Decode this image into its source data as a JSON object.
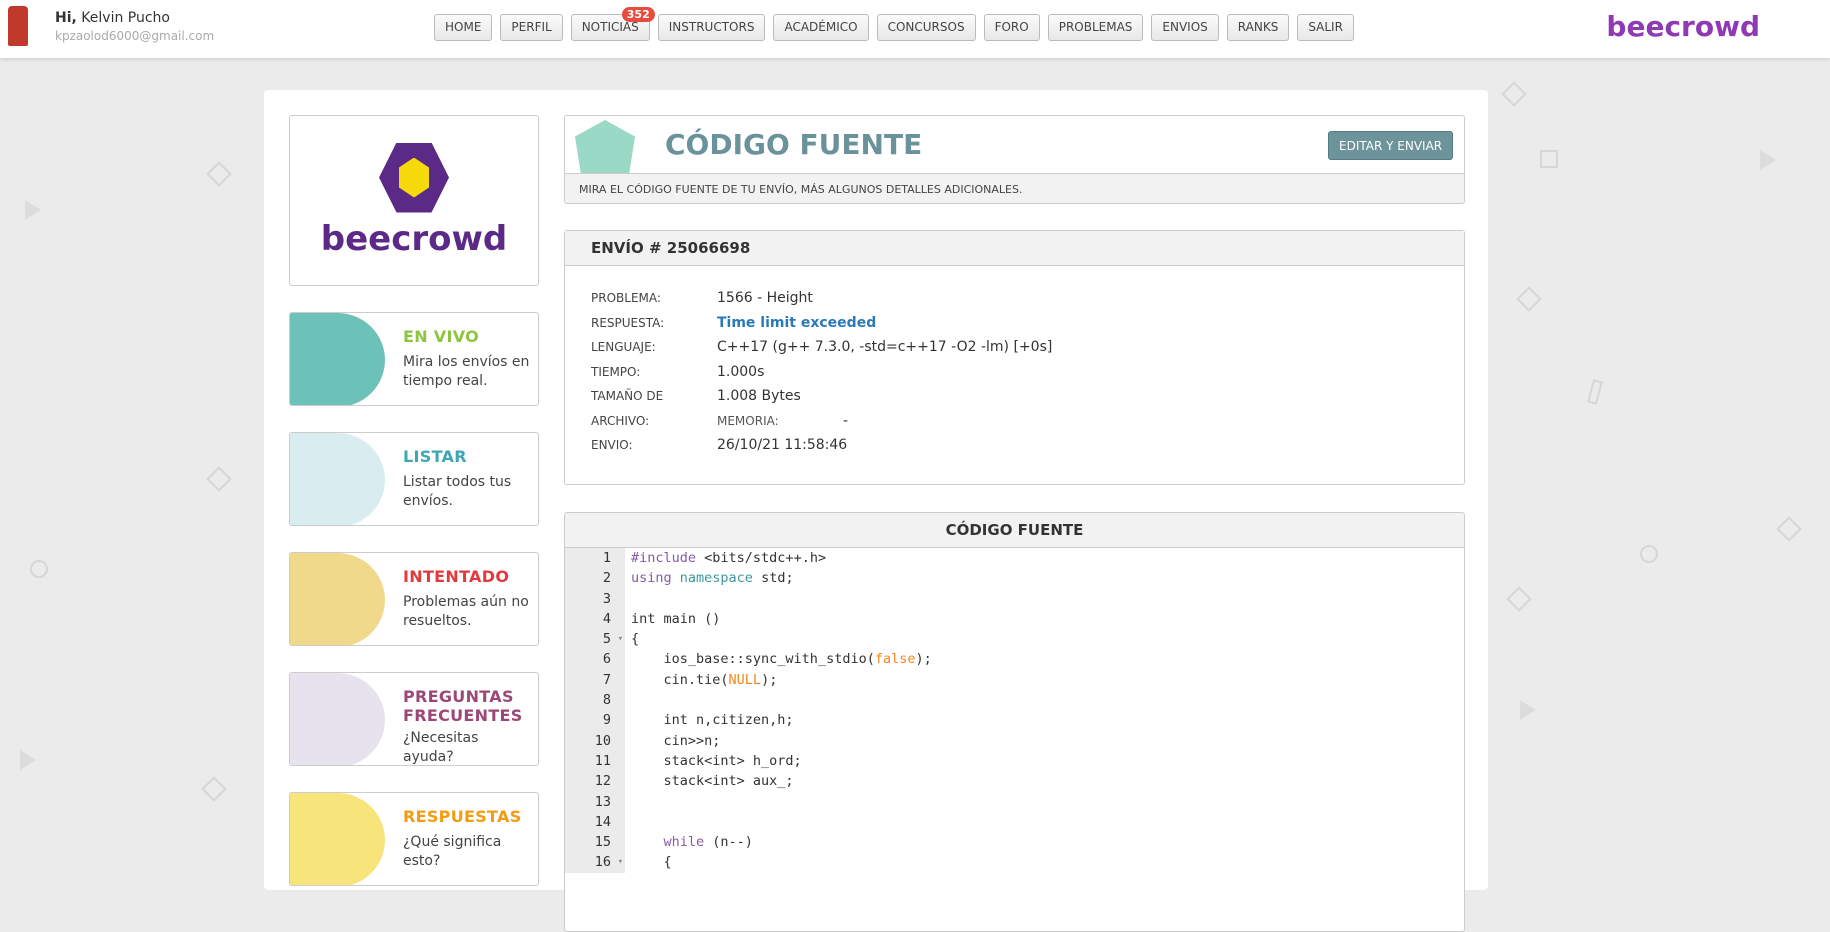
{
  "user": {
    "greeting": "Hi,",
    "name": "Kelvin Pucho",
    "email": "kpzaolod6000@gmail.com"
  },
  "nav": [
    {
      "label": "HOME"
    },
    {
      "label": "PERFIL"
    },
    {
      "label": "NOTICIAS",
      "badge": "352"
    },
    {
      "label": "INSTRUCTORS"
    },
    {
      "label": "ACADÉMICO"
    },
    {
      "label": "CONCURSOS"
    },
    {
      "label": "FORO"
    },
    {
      "label": "PROBLEMAS"
    },
    {
      "label": "ENVIOS"
    },
    {
      "label": "RANKS"
    },
    {
      "label": "SALIR"
    }
  ],
  "brand": "beecrowd",
  "sidebar": {
    "logo_text": "beecrowd",
    "cards": [
      {
        "title": "EN VIVO",
        "desc": "Mira los envíos en tiempo real.",
        "color": "#8cc63f"
      },
      {
        "title": "LISTAR",
        "desc": "Listar todos tus envíos.",
        "color": "#3ea6b5"
      },
      {
        "title": "INTENTADO",
        "desc": "Problemas aún no resueltos.",
        "color": "#e03a3e"
      },
      {
        "title": "PREGUNTAS FRECUENTES",
        "desc": "¿Necesitas ayuda?",
        "color": "#9b4777"
      },
      {
        "title": "RESPUESTAS",
        "desc": "¿Qué significa esto?",
        "color": "#f39c12"
      }
    ]
  },
  "page": {
    "title": "CÓDIGO FUENTE",
    "edit_button": "EDITAR Y ENVIAR",
    "description": "MIRA EL CÓDIGO FUENTE DE TU ENVÍO, MÁS ALGUNOS DETALLES ADICIONALES."
  },
  "submission": {
    "heading": "ENVÍO # 25066698",
    "rows": [
      {
        "label": "PROBLEMA:",
        "value": "1566 - Height"
      },
      {
        "label": "RESPUESTA:",
        "value": "Time limit exceeded"
      },
      {
        "label": "LENGUAJE:",
        "value": "C++17 (g++ 7.3.0, -std=c++17 -O2 -lm) [+0s]"
      },
      {
        "label": "TIEMPO:",
        "value": "1.000s"
      },
      {
        "label": "TAMAÑO DE",
        "value": "1.008 Bytes"
      },
      {
        "label": "ARCHIVO:",
        "value": "MEMORIA:",
        "extra": "-"
      },
      {
        "label": "ENVIO:",
        "value": "26/10/21 11:58:46"
      }
    ]
  },
  "code": {
    "heading": "CÓDIGO FUENTE",
    "lines": [
      "#include <bits/stdc++.h>",
      "using namespace std;",
      "",
      "int main ()",
      "{",
      "    ios_base::sync_with_stdio(false);",
      "    cin.tie(NULL);",
      "",
      "    int n,citizen,h;",
      "    cin>>n;",
      "    stack<int> h_ord;",
      "    stack<int> aux_;",
      "",
      "",
      "    while (n--)",
      "    {"
    ],
    "fold_lines": [
      5,
      16
    ]
  }
}
